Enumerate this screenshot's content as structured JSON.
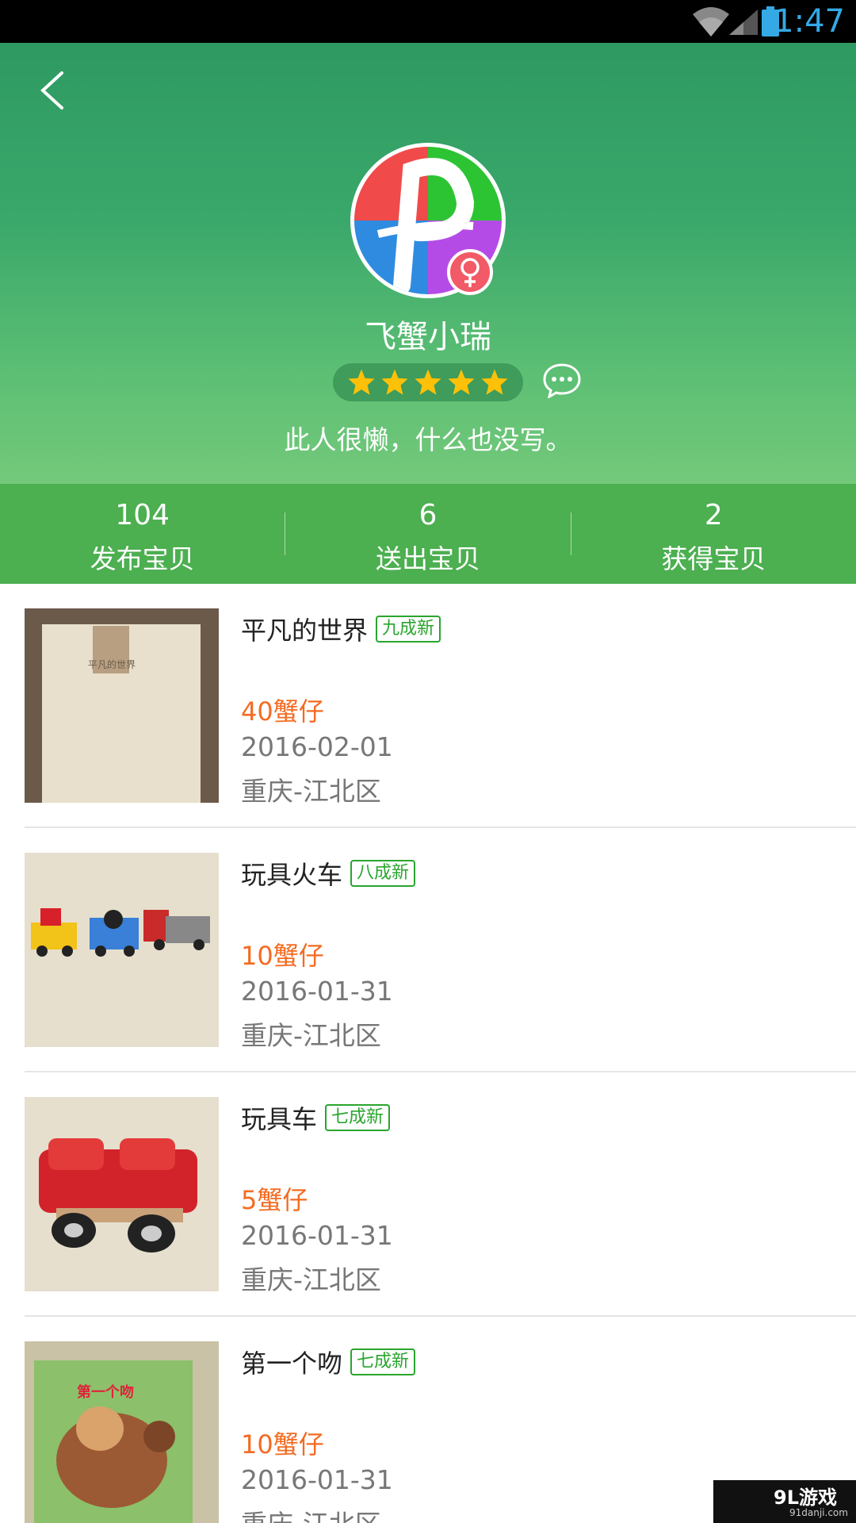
{
  "status_bar": {
    "time": "1:47"
  },
  "profile": {
    "nickname": "飞蟹小瑞",
    "rating_stars": 5,
    "signature": "此人很懒，什么也没写。"
  },
  "stats": [
    {
      "count": "104",
      "label": "发布宝贝"
    },
    {
      "count": "6",
      "label": "送出宝贝"
    },
    {
      "count": "2",
      "label": "获得宝贝"
    }
  ],
  "items": [
    {
      "title": "平凡的世界",
      "condition": "九成新",
      "price": "40蟹仔",
      "date": "2016-02-01",
      "location": "重庆-江北区"
    },
    {
      "title": "玩具火车",
      "condition": "八成新",
      "price": "10蟹仔",
      "date": "2016-01-31",
      "location": "重庆-江北区"
    },
    {
      "title": "玩具车",
      "condition": "七成新",
      "price": "5蟹仔",
      "date": "2016-01-31",
      "location": "重庆-江北区"
    },
    {
      "title": "第一个吻",
      "condition": "七成新",
      "price": "10蟹仔",
      "date": "2016-01-31",
      "location": "重庆-江北区"
    }
  ],
  "thumbnails": {
    "book1_cover_text": "平凡的世界",
    "book4_cover_text": "第一个吻"
  },
  "watermark": {
    "brand": "9L游戏",
    "site": "91danji.com"
  },
  "colors": {
    "accent_green": "#4caf50",
    "price_orange": "#f46b21",
    "tag_green": "#2aa52e",
    "status_time": "#35a9e6"
  }
}
